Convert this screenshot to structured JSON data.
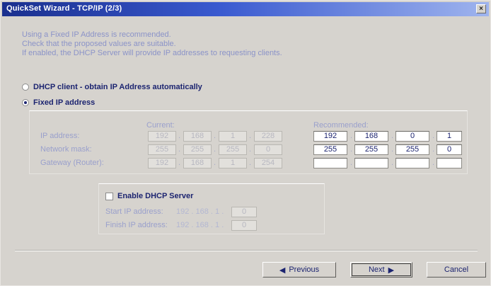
{
  "window": {
    "title": "QuickSet Wizard - TCP/IP (2/3)",
    "close_glyph": "×"
  },
  "info_lines": [
    "Using a Fixed IP Address is recommended.",
    "Check that the proposed values are suitable.",
    "If enabled, the DHCP Server will provide IP addresses to requesting clients."
  ],
  "options": {
    "dhcp_client": {
      "label": "DHCP client - obtain IP Address automatically",
      "selected": false
    },
    "fixed_ip": {
      "label": "Fixed IP address",
      "selected": true
    }
  },
  "fields": {
    "current_header": "Current:",
    "recommended_header": "Recommended:",
    "rows": [
      {
        "label": "IP address:",
        "current": [
          "192",
          "168",
          "1",
          "228"
        ],
        "recommended": [
          "192",
          "168",
          "0",
          "1"
        ]
      },
      {
        "label": "Network mask:",
        "current": [
          "255",
          "255",
          "255",
          "0"
        ],
        "recommended": [
          "255",
          "255",
          "255",
          "0"
        ]
      },
      {
        "label": "Gateway (Router):",
        "current": [
          "192",
          "168",
          "1",
          "254"
        ],
        "recommended": [
          "",
          "",
          "",
          ""
        ]
      }
    ]
  },
  "dhcp_server": {
    "label": "Enable DHCP Server",
    "checked": false,
    "start_label": "Start IP address:",
    "start_prefix": "192 . 168 . 1 .",
    "start_value": "0",
    "finish_label": "Finish IP address:",
    "finish_prefix": "192 . 168 . 1 .",
    "finish_value": "0"
  },
  "buttons": {
    "previous": "Previous",
    "next": "Next",
    "cancel": "Cancel",
    "previous_arrow": "◀",
    "next_arrow": "▶"
  },
  "colors": {
    "titlebar_start": "#1a2f8e",
    "titlebar_end": "#9fb4ee",
    "text": "#1c2470",
    "dialog_bg": "#d6d3ce"
  }
}
